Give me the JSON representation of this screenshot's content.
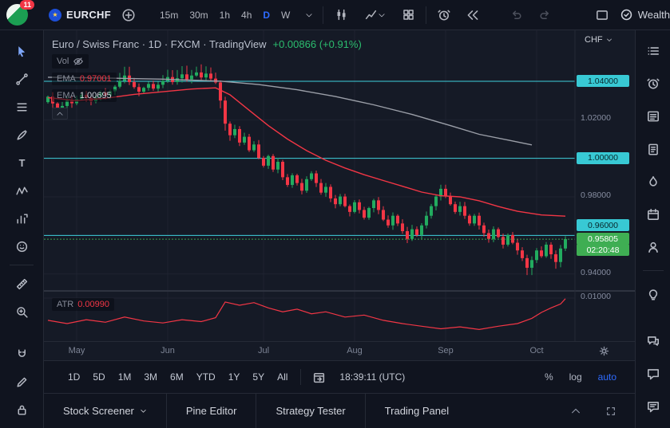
{
  "topbar": {
    "notification_count": "11",
    "symbol": "EURCHF",
    "timeframes": [
      "15m",
      "30m",
      "1h",
      "4h",
      "D",
      "W"
    ],
    "active_timeframe": "D",
    "wealth_label": "Wealth"
  },
  "left_toolbar": {
    "tools": [
      "cursor",
      "trend-line",
      "fib-retracement",
      "brush",
      "text",
      "xabcd-pattern",
      "forecast",
      "emoji",
      "ruler",
      "zoom",
      "magnet",
      "drawing-mode",
      "lock"
    ]
  },
  "right_toolbar": {
    "icons": [
      "watchlist",
      "alerts",
      "news",
      "data-window",
      "hotlists",
      "calendar",
      "my-ideas",
      "ideas",
      "chats",
      "comments",
      "help"
    ]
  },
  "legend": {
    "title": "Euro / Swiss Franc · 1D · FXCM · TradingView",
    "change": "+0.00866 (+0.91%)",
    "vol": "Vol",
    "ema_fast": {
      "label": "EMA",
      "value": "0.97001"
    },
    "ema_slow": {
      "label": "EMA",
      "value": "1.00695"
    },
    "atr": {
      "label": "ATR",
      "value": "0.00990"
    }
  },
  "price_axis": {
    "currency": "CHF",
    "countdown": "02:20:48",
    "last_price_label": "0.95805"
  },
  "range_bar": {
    "ranges": [
      "1D",
      "5D",
      "1M",
      "3M",
      "6M",
      "YTD",
      "1Y",
      "5Y",
      "All"
    ],
    "clock": "18:39:11 (UTC)",
    "percent_label": "%",
    "log_label": "log",
    "auto_label": "auto"
  },
  "panel_tabs": {
    "tabs": [
      "Stock Screener",
      "Pine Editor",
      "Strategy Tester",
      "Trading Panel"
    ]
  },
  "chart_data": {
    "type": "candlestick",
    "symbol": "EUR/CHF",
    "timeframe": "1D",
    "exchange": "FXCM",
    "title": "Euro / Swiss Franc · 1D · FXCM · TradingView",
    "last_price": 0.95805,
    "change_abs": "+0.00866",
    "change_pct": "+0.91%",
    "countdown": "02:20:48",
    "ylim": [
      0.931,
      1.064
    ],
    "price_ticks": [
      1.04,
      1.02,
      1.0,
      0.98,
      0.96,
      0.94
    ],
    "level_lines": [
      1.04,
      1.0,
      0.96
    ],
    "open_first": 1.0292,
    "closes": [
      1.032,
      1.0285,
      1.0255,
      1.0272,
      1.03,
      1.0286,
      1.0308,
      1.033,
      1.0314,
      1.0296,
      1.032,
      1.0342,
      1.0326,
      1.0348,
      1.0372,
      1.0402,
      1.043,
      1.0396,
      1.037,
      1.0346,
      1.0366,
      1.0386,
      1.0362,
      1.0382,
      1.0402,
      1.0422,
      1.0396,
      1.0416,
      1.0436,
      1.041,
      1.043,
      1.0446,
      1.042,
      1.044,
      1.0414,
      1.0394,
      1.03,
      1.018,
      1.012,
      1.0152,
      1.0082,
      1.0112,
      1.0042,
      1.0072,
      1.0002,
      0.9962,
      1.0012,
      0.9942,
      0.9982,
      0.9902,
      0.9862,
      0.9912,
      0.9872,
      0.9832,
      0.9892,
      0.9922,
      0.9872,
      0.9822,
      0.9852,
      0.9792,
      0.9762,
      0.9802,
      0.9752,
      0.9722,
      0.9772,
      0.9732,
      0.9692,
      0.9742,
      0.9782,
      0.9732,
      0.9682,
      0.9652,
      0.9702,
      0.9662,
      0.9622,
      0.9582,
      0.9632,
      0.9602,
      0.9652,
      0.9702,
      0.9752,
      0.9802,
      0.9842,
      0.9802,
      0.9762,
      0.9722,
      0.9752,
      0.9702,
      0.9662,
      0.9702,
      0.9652,
      0.9612,
      0.9582,
      0.9632,
      0.9592,
      0.9552,
      0.9602,
      0.9562,
      0.9522,
      0.9482,
      0.9432,
      0.9472,
      0.9522,
      0.9492,
      0.9552,
      0.9502,
      0.9462,
      0.9532,
      0.95805
    ],
    "months": [
      {
        "label": "May",
        "i": 6
      },
      {
        "label": "Jun",
        "i": 25
      },
      {
        "label": "Jul",
        "i": 45
      },
      {
        "label": "Aug",
        "i": 64
      },
      {
        "label": "Sep",
        "i": 83
      },
      {
        "label": "Oct",
        "i": 102
      }
    ],
    "ema_fast": {
      "label": "EMA",
      "value": 0.97001,
      "color": "#f23645",
      "points": [
        [
          0,
          1.0315
        ],
        [
          6,
          1.03
        ],
        [
          12,
          1.0312
        ],
        [
          18,
          1.0332
        ],
        [
          24,
          1.0346
        ],
        [
          30,
          1.036
        ],
        [
          35,
          1.0366
        ],
        [
          38,
          1.033
        ],
        [
          42,
          1.025
        ],
        [
          46,
          1.017
        ],
        [
          50,
          1.01
        ],
        [
          54,
          1.004
        ],
        [
          58,
          0.999
        ],
        [
          62,
          0.995
        ],
        [
          66,
          0.9915
        ],
        [
          70,
          0.9885
        ],
        [
          74,
          0.9855
        ],
        [
          78,
          0.9825
        ],
        [
          82,
          0.9806
        ],
        [
          86,
          0.98
        ],
        [
          90,
          0.978
        ],
        [
          94,
          0.975
        ],
        [
          98,
          0.9725
        ],
        [
          103,
          0.9706
        ],
        [
          108,
          0.97
        ]
      ]
    },
    "ema_slow": {
      "label": "EMA",
      "value": 1.00695,
      "color": "#9b9fa8",
      "points": [
        [
          0,
          1.0421
        ],
        [
          12,
          1.0417
        ],
        [
          24,
          1.0411
        ],
        [
          36,
          1.0401
        ],
        [
          44,
          1.0383
        ],
        [
          52,
          1.0356
        ],
        [
          60,
          1.0321
        ],
        [
          68,
          1.0278
        ],
        [
          76,
          1.0228
        ],
        [
          84,
          1.017
        ],
        [
          90,
          1.0125
        ],
        [
          96,
          1.0095
        ],
        [
          101,
          1.007
        ]
      ]
    },
    "atr": {
      "label": "ATR",
      "value": 0.0099,
      "tick": 0.01,
      "color": "#f23645",
      "points": [
        [
          0,
          0.0066
        ],
        [
          4,
          0.0061
        ],
        [
          8,
          0.0067
        ],
        [
          12,
          0.0063
        ],
        [
          16,
          0.0071
        ],
        [
          20,
          0.0065
        ],
        [
          24,
          0.0062
        ],
        [
          28,
          0.0067
        ],
        [
          32,
          0.0064
        ],
        [
          35,
          0.007
        ],
        [
          37,
          0.0094
        ],
        [
          40,
          0.0089
        ],
        [
          43,
          0.0093
        ],
        [
          46,
          0.0085
        ],
        [
          49,
          0.0079
        ],
        [
          52,
          0.0083
        ],
        [
          55,
          0.0076
        ],
        [
          58,
          0.0079
        ],
        [
          62,
          0.0071
        ],
        [
          66,
          0.0074
        ],
        [
          70,
          0.0066
        ],
        [
          74,
          0.0061
        ],
        [
          78,
          0.0057
        ],
        [
          82,
          0.0053
        ],
        [
          86,
          0.0056
        ],
        [
          90,
          0.0052
        ],
        [
          94,
          0.0057
        ],
        [
          98,
          0.0061
        ],
        [
          101,
          0.0069
        ],
        [
          103,
          0.0078
        ],
        [
          105,
          0.0085
        ],
        [
          107,
          0.0091
        ],
        [
          108,
          0.0099
        ]
      ]
    },
    "colors": {
      "up": "#22ab5f",
      "down": "#f23645",
      "level": "#3fd0dc",
      "last_line": "#3fae53",
      "grid": "#1e2330"
    }
  }
}
